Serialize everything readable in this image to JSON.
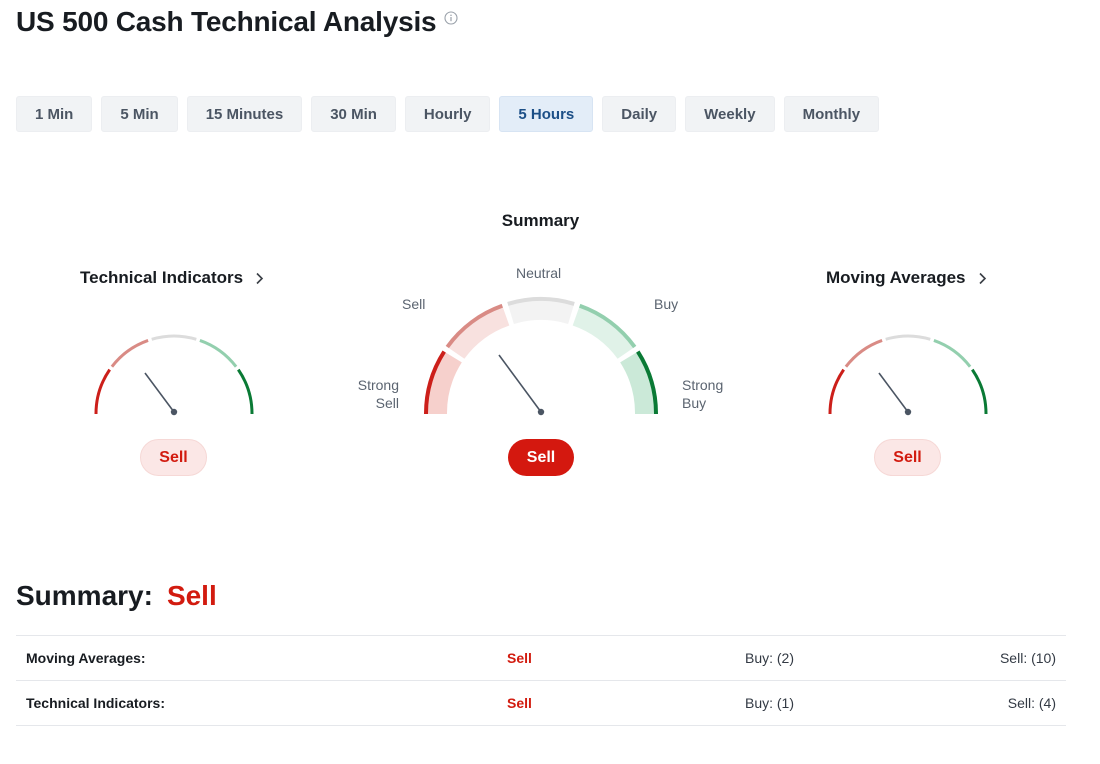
{
  "page": {
    "title": "US 500 Cash Technical Analysis",
    "info_icon": "info-circle-icon"
  },
  "timeframes": [
    {
      "label": "1 Min",
      "active": false
    },
    {
      "label": "5 Min",
      "active": false
    },
    {
      "label": "15 Minutes",
      "active": false
    },
    {
      "label": "30 Min",
      "active": false
    },
    {
      "label": "Hourly",
      "active": false
    },
    {
      "label": "5 Hours",
      "active": true
    },
    {
      "label": "Daily",
      "active": false
    },
    {
      "label": "Weekly",
      "active": false
    },
    {
      "label": "Monthly",
      "active": false
    }
  ],
  "gauges": {
    "technical_indicators": {
      "title": "Technical Indicators",
      "signal": "Sell",
      "icon": "chevron-right-icon"
    },
    "summary": {
      "title": "Summary",
      "signal": "Sell",
      "labels": {
        "strong_sell": [
          "Strong",
          "Sell"
        ],
        "sell": "Sell",
        "neutral": "Neutral",
        "buy": "Buy",
        "strong_buy": [
          "Strong",
          "Buy"
        ]
      }
    },
    "moving_averages": {
      "title": "Moving Averages",
      "signal": "Sell",
      "icon": "chevron-right-icon"
    }
  },
  "summary": {
    "label": "Summary:",
    "value": "Sell",
    "rows": [
      {
        "name": "Moving Averages:",
        "signal": "Sell",
        "buy": "Buy: (2)",
        "sell": "Sell: (10)"
      },
      {
        "name": "Technical Indicators:",
        "signal": "Sell",
        "buy": "Buy: (1)",
        "sell": "Sell: (4)"
      }
    ]
  },
  "colors": {
    "strong_sell": "#cc1f1a",
    "sell": "#d98b85",
    "neutral": "#dcdcdc",
    "buy": "#93cfae",
    "strong_buy": "#0a7a35",
    "active_tab": "#1c4f87"
  }
}
